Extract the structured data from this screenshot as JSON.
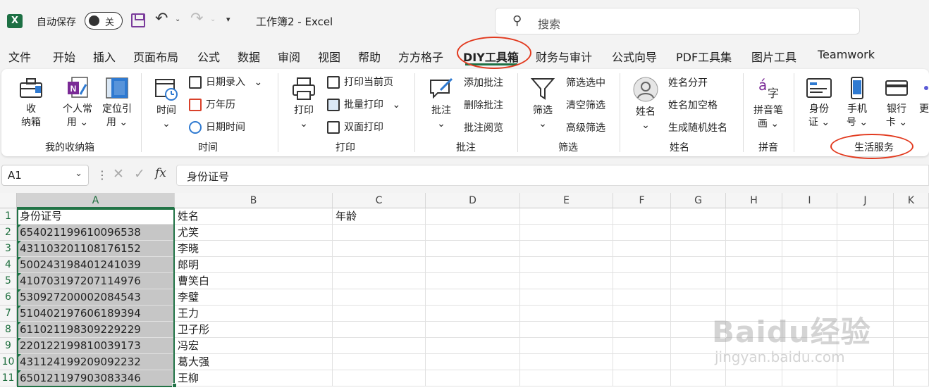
{
  "titlebar": {
    "app_icon": "X",
    "autosave_label": "自动保存",
    "autosave_state": "关",
    "doc_title": "工作簿2  -  Excel",
    "search_placeholder": "搜索"
  },
  "tabs": [
    "文件",
    "开始",
    "插入",
    "页面布局",
    "公式",
    "数据",
    "审阅",
    "视图",
    "帮助",
    "方方格子",
    "DIY工具箱",
    "财务与审计",
    "公式向导",
    "PDF工具集",
    "图片工具",
    "Teamwork"
  ],
  "active_tab": "DIY工具箱",
  "ribbon": {
    "groups": {
      "storage": {
        "label": "我的收纳箱",
        "buttons": [
          {
            "line1": "收",
            "line2": "纳箱"
          },
          {
            "line1": "个人常",
            "line2": "用 ⌄"
          },
          {
            "line1": "定位引",
            "line2": "用 ⌄"
          }
        ]
      },
      "time": {
        "label": "时间",
        "big": {
          "line1": "时间",
          "line2": "⌄"
        },
        "items": [
          "日期录入",
          "万年历",
          "日期时间"
        ]
      },
      "print": {
        "label": "打印",
        "big": {
          "line1": "打印",
          "line2": "⌄"
        },
        "items": [
          "打印当前页",
          "批量打印",
          "双面打印"
        ]
      },
      "comment": {
        "label": "批注",
        "big": {
          "line1": "批注",
          "line2": "⌄"
        },
        "items": [
          "添加批注",
          "删除批注",
          "批注阅览"
        ]
      },
      "filter": {
        "label": "筛选",
        "big": {
          "line1": "筛选",
          "line2": "⌄"
        },
        "items": [
          "筛选选中",
          "清空筛选",
          "高级筛选"
        ]
      },
      "name": {
        "label": "姓名",
        "big": {
          "line1": "姓名",
          "line2": "⌄"
        },
        "items": [
          "姓名分开",
          "姓名加空格",
          "生成随机姓名"
        ]
      },
      "pinyin": {
        "label": "拼音",
        "big": {
          "line1": "拼音笔",
          "line2": "画 ⌄"
        }
      },
      "life": {
        "label": "生活服务",
        "buttons": [
          {
            "line1": "身份",
            "line2": "证 ⌄"
          },
          {
            "line1": "手机",
            "line2": "号 ⌄"
          },
          {
            "line1": "银行",
            "line2": "卡 ⌄"
          },
          {
            "line1": "更",
            "line2": ""
          }
        ]
      }
    }
  },
  "formula_bar": {
    "name_box": "A1",
    "fx": "fx",
    "content": "身份证号"
  },
  "sheet": {
    "columns": [
      "A",
      "B",
      "C",
      "D",
      "E",
      "F",
      "G",
      "H",
      "I",
      "J",
      "K"
    ],
    "rows": [
      {
        "n": "1",
        "a": "身份证号",
        "b": "姓名",
        "c": "年龄"
      },
      {
        "n": "2",
        "a": "654021199610096538",
        "b": "尤笑",
        "c": ""
      },
      {
        "n": "3",
        "a": "431103201108176152",
        "b": "李晓",
        "c": ""
      },
      {
        "n": "4",
        "a": "500243198401241039",
        "b": "郎明",
        "c": ""
      },
      {
        "n": "5",
        "a": "410703197207114976",
        "b": "曹笑白",
        "c": ""
      },
      {
        "n": "6",
        "a": "530927200002084543",
        "b": "李璧",
        "c": ""
      },
      {
        "n": "7",
        "a": "510402197606189394",
        "b": "王力",
        "c": ""
      },
      {
        "n": "8",
        "a": "611021198309229229",
        "b": "卫子彤",
        "c": ""
      },
      {
        "n": "9",
        "a": "220122199810039173",
        "b": "冯宏",
        "c": ""
      },
      {
        "n": "10",
        "a": "431124199209092232",
        "b": "葛大强",
        "c": ""
      },
      {
        "n": "11",
        "a": "650121197903083346",
        "b": "王柳",
        "c": ""
      }
    ]
  },
  "watermark": {
    "brand": "Baidu经验",
    "url": "jingyan.baidu.com"
  },
  "colors": {
    "excel_green": "#217346",
    "highlight_red": "#e23a1f",
    "selection_gray": "#c6c6c6"
  }
}
